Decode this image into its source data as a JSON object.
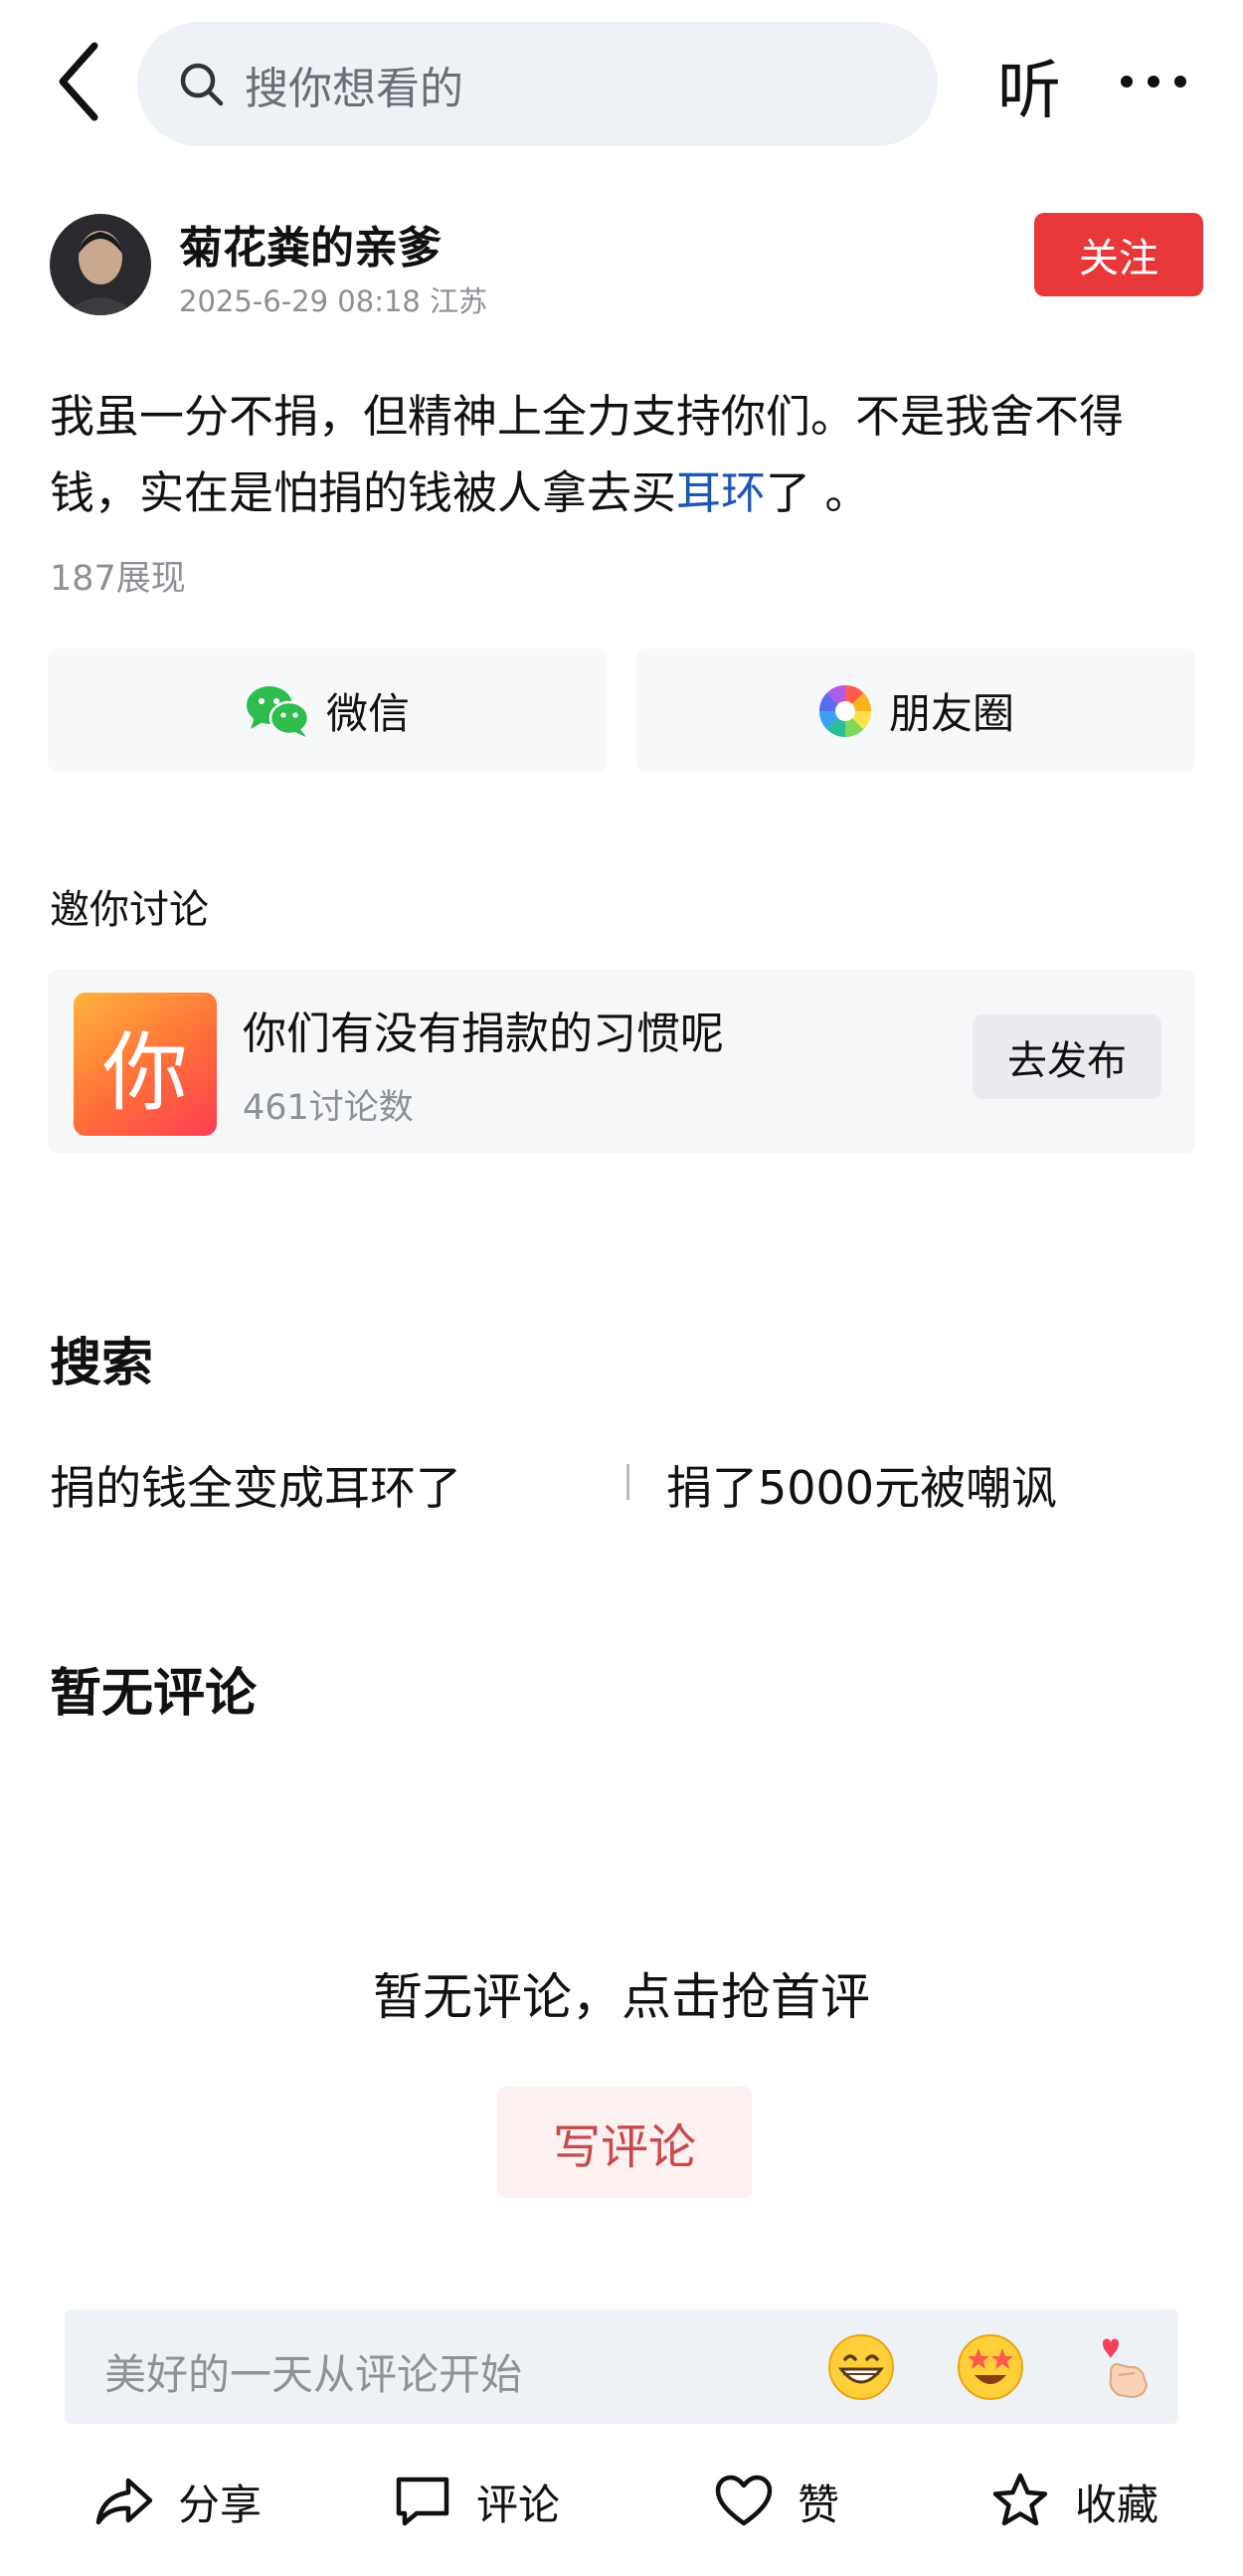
{
  "top_bar": {
    "search_placeholder": "搜你想看的",
    "listen_label": "听"
  },
  "author": {
    "name": "菊花粪的亲爹",
    "datetime": "2025-6-29 08:18",
    "location": "江苏",
    "follow_label": "关注"
  },
  "post": {
    "text_before": "我虽一分不捐，但精神上全力支持你们。不是我舍不得钱，实在是怕捐的钱被人拿去买",
    "link_text": "耳环",
    "text_after": "了 。",
    "views": "187展现"
  },
  "share": {
    "wechat_label": "微信",
    "moments_label": "朋友圈"
  },
  "invite": {
    "title": "邀你讨论",
    "topic_icon_char": "你",
    "topic_title": "你们有没有捐款的习惯呢",
    "topic_count": "461讨论数",
    "publish_label": "去发布"
  },
  "search_section": {
    "heading": "搜索",
    "suggestions": [
      "捐的钱全变成耳环了",
      "捐了5000元被嘲讽"
    ]
  },
  "comments": {
    "heading": "暂无评论",
    "empty_text": "暂无评论，点击抢首评",
    "write_label": "写评论"
  },
  "comment_bar": {
    "placeholder": "美好的一天从评论开始",
    "emojis": [
      "grinning-emoji",
      "star-eyes-emoji",
      "finger-heart-emoji"
    ]
  },
  "bottom_bar": {
    "share_label": "分享",
    "comment_label": "评论",
    "like_label": "赞",
    "favorite_label": "收藏"
  },
  "colors": {
    "follow_red": "#e9383a",
    "link_blue": "#1d57b5",
    "write_comment_text": "#c8484b",
    "input_bg": "#eef2f7"
  }
}
